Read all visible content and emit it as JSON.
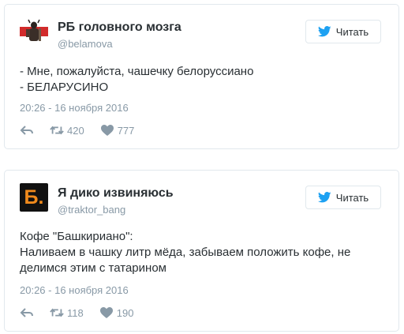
{
  "tweets": [
    {
      "author_name": "РБ головного мозга",
      "handle": "@belamova",
      "follow_label": "Читать",
      "text": "- Мне, пожалуйста, чашечку белоруссиано\n- БЕЛАРУСИНО",
      "timestamp": "20:26 - 16 ноября 2016",
      "retweets": "420",
      "likes": "777",
      "icons": [
        "reply-icon",
        "retweet-icon",
        "heart-icon",
        "twitter-bird-icon"
      ]
    },
    {
      "author_name": "Я дико извиняюсь",
      "handle": "@traktor_bang",
      "follow_label": "Читать",
      "avatar_letter": "Б.",
      "text": "Кофе \"Башкириано\":\nНаливаем в чашку литр мёда, забываем положить кофе, не\nделимся этим с татарином",
      "timestamp": "20:26 - 16 ноября 2016",
      "retweets": "118",
      "likes": "190",
      "icons": [
        "reply-icon",
        "retweet-icon",
        "heart-icon",
        "twitter-bird-icon"
      ]
    }
  ],
  "colors": {
    "twitter_blue": "#1da1f2",
    "muted": "#8899a6",
    "border": "#e1e8ed",
    "avatar2_orange": "#f08a1c"
  }
}
